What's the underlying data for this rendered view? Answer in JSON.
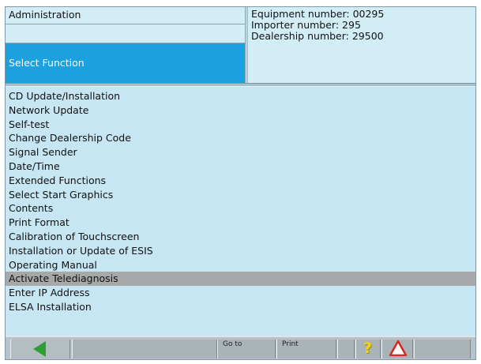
{
  "header": {
    "title": "Administration",
    "section": "Select Function",
    "info": {
      "equipment": "Equipment number: 00295",
      "importer": "Importer number: 295",
      "dealership": "Dealership number: 29500"
    }
  },
  "functions": [
    "CD Update/Installation",
    "Network Update",
    "Self-test",
    "Change Dealership Code",
    "Signal Sender",
    "Date/Time",
    "Extended Functions",
    "Select Start Graphics",
    "Contents",
    "Print Format",
    "Calibration of Touchscreen",
    "Installation or Update of ESIS",
    "Operating Manual",
    "Activate Telediagnosis",
    "Enter IP Address",
    "ELSA Installation"
  ],
  "selected_function": "Activate Telediagnosis",
  "toolbar": {
    "back_icon": "back-arrow-icon",
    "goto_label": "Go to",
    "print_label": "Print",
    "help_icon": "help-icon",
    "warning_icon": "warning-icon"
  },
  "colors": {
    "screen_background": "#c6e6f3",
    "selected_header": "#1aa1de",
    "selected_row": "#a6a8a9",
    "toolbar": "#b9c2c6"
  }
}
